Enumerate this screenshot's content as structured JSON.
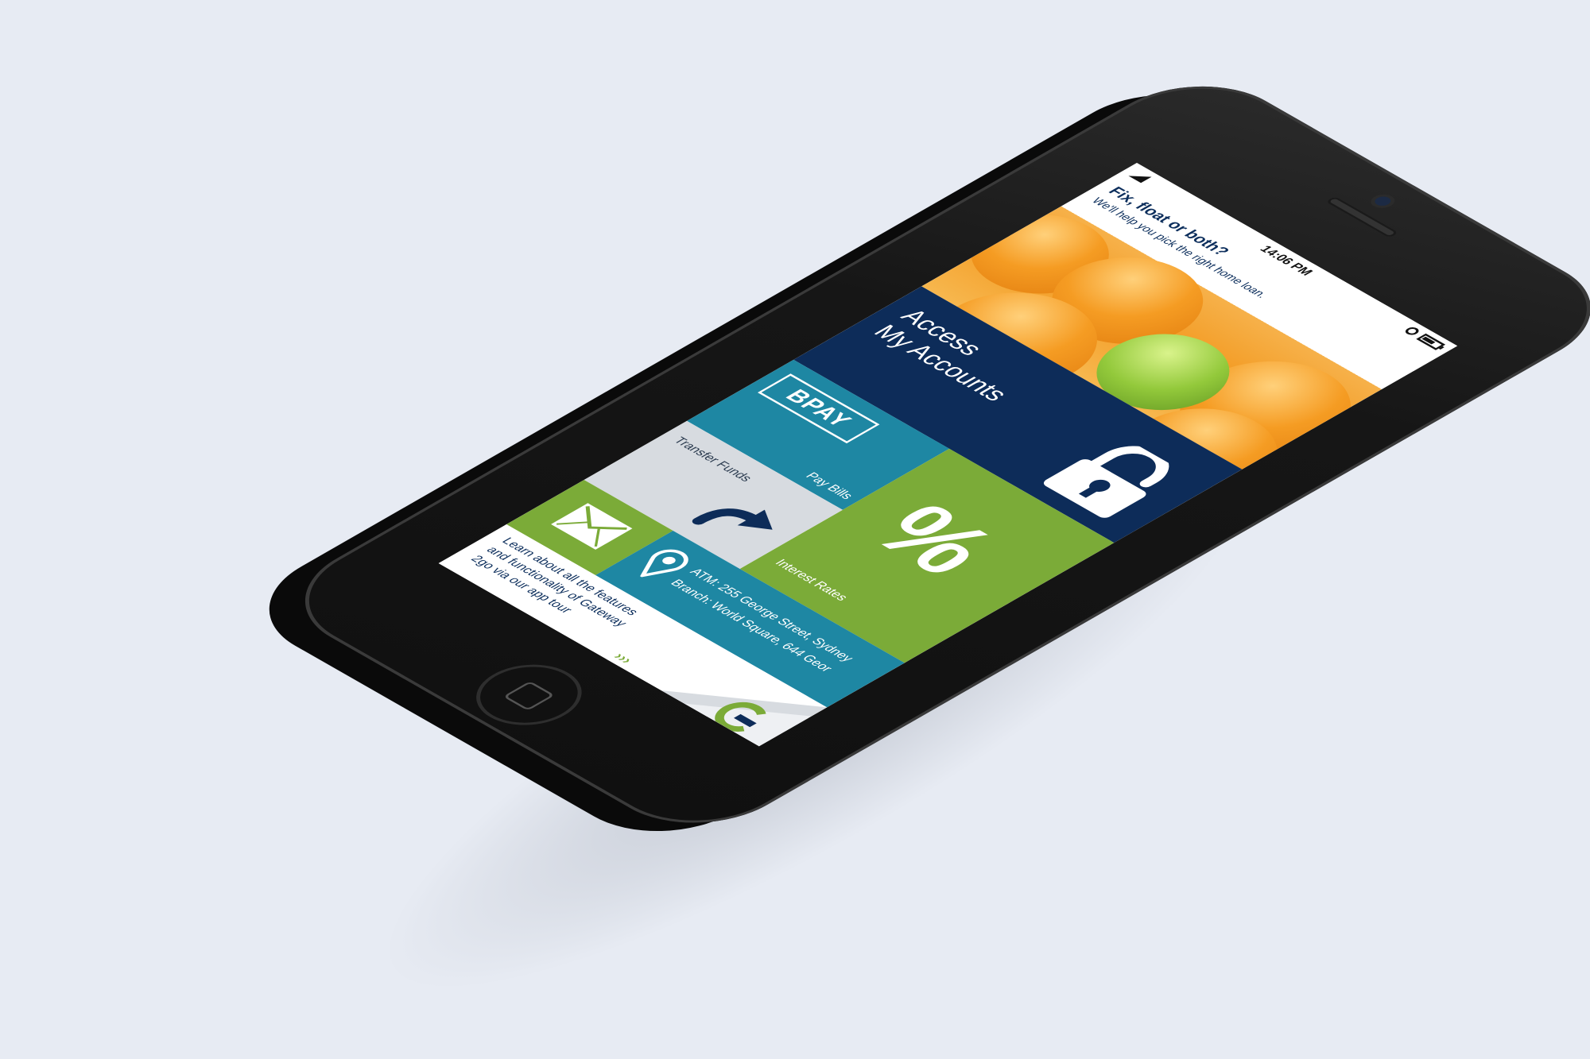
{
  "status_bar": {
    "time": "14:06 PM",
    "signal_icon": "signal-icon",
    "clock_icon": "clock-icon",
    "battery_icon": "battery-icon"
  },
  "banner": {
    "title": "Fix, float or both?",
    "subtitle": "We'll help you pick the right home loan."
  },
  "tiles": {
    "accounts": {
      "line1": "Access",
      "line2": "My Accounts",
      "icon": "padlock-icon"
    },
    "bpay": {
      "logo": "BPAY",
      "label": "Pay Bills"
    },
    "interest_rates": {
      "glyph": "%",
      "label": "Interest Rates"
    },
    "transfer": {
      "label": "Transfer Funds",
      "icon": "transfer-arrow-icon"
    },
    "mail": {
      "icon": "envelope-icon"
    },
    "atm": {
      "icon": "location-pin-icon",
      "atm": "ATM: 255 George Street, Sydney",
      "branch": "Branch: World Square, 644 Geor"
    }
  },
  "tour": {
    "line1": "Learn about all the features",
    "line2": "and functionality of Gateway",
    "line3": "2go via our app tour",
    "chevrons": "›››",
    "logo_icon": "gateway-logo-icon"
  },
  "colors": {
    "background": "#e7ebf3",
    "navy": "#0d2c59",
    "teal": "#1e87a3",
    "green": "#7bab38",
    "grey_tile": "#d7dbe0",
    "orange": "#f39c25"
  }
}
